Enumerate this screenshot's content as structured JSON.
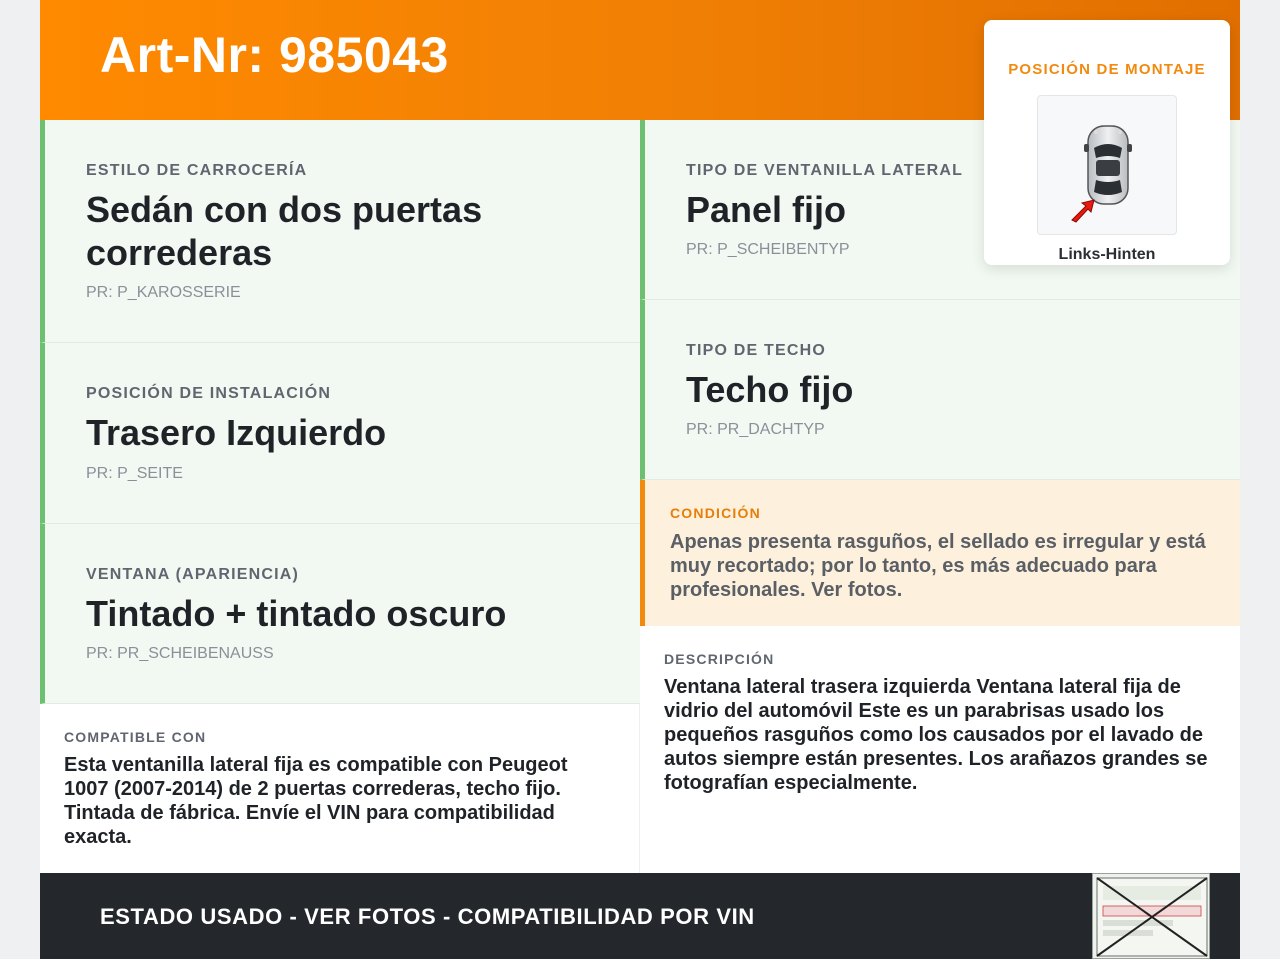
{
  "header": {
    "title": "Art-Nr: 985043"
  },
  "specs_left": [
    {
      "label": "ESTILO DE CARROCERÍA",
      "value": "Sedán con dos puertas correderas",
      "pr": "PR: P_KAROSSERIE"
    },
    {
      "label": "POSICIÓN DE INSTALACIÓN",
      "value": "Trasero Izquierdo",
      "pr": "PR: P_SEITE"
    },
    {
      "label": "VENTANA (APARIENCIA)",
      "value": "Tintado + tintado oscuro",
      "pr": "PR: PR_SCHEIBENAUSS"
    }
  ],
  "specs_right": [
    {
      "label": "TIPO DE VENTANILLA LATERAL",
      "value": "Panel fijo",
      "pr": "PR: P_SCHEIBENTYP"
    },
    {
      "label": "TIPO DE TECHO",
      "value": "Techo fijo",
      "pr": "PR: PR_DACHTYP"
    }
  ],
  "mounting": {
    "title": "POSICIÓN DE MONTAJE",
    "position": "Links-Hinten",
    "icon": "car-top-view-icon"
  },
  "condition": {
    "label": "CONDICIÓN",
    "text": "Apenas presenta rasguños, el sellado es irregular y está muy recortado; por lo tanto, es más adecuado para profesionales. Ver fotos."
  },
  "compatible": {
    "label": "COMPATIBLE CON",
    "text": "Esta ventanilla lateral fija es compatible con Peugeot 1007 (2007-2014) de 2 puertas correderas, techo fijo. Tintada de fábrica. Envíe el VIN para compatibilidad exacta."
  },
  "description": {
    "label": "DESCRIPCIÓN",
    "text": "Ventana lateral trasera izquierda Ventana lateral fija de vidrio del automóvil Este es un parabrisas usado los pequeños rasguños como los causados por el lavado de autos siempre están presentes. Los arañazos grandes se fotografían especialmente."
  },
  "footer": {
    "text": "ESTADO USADO - VER FOTOS - COMPATIBILIDAD POR VIN",
    "stamp_icon": "vin-sticker-thumbnail"
  },
  "colors": {
    "accent": "#ff8a00",
    "green": "#6cc070",
    "dark": "#24272c",
    "condition_bg": "#fdf0dc"
  }
}
